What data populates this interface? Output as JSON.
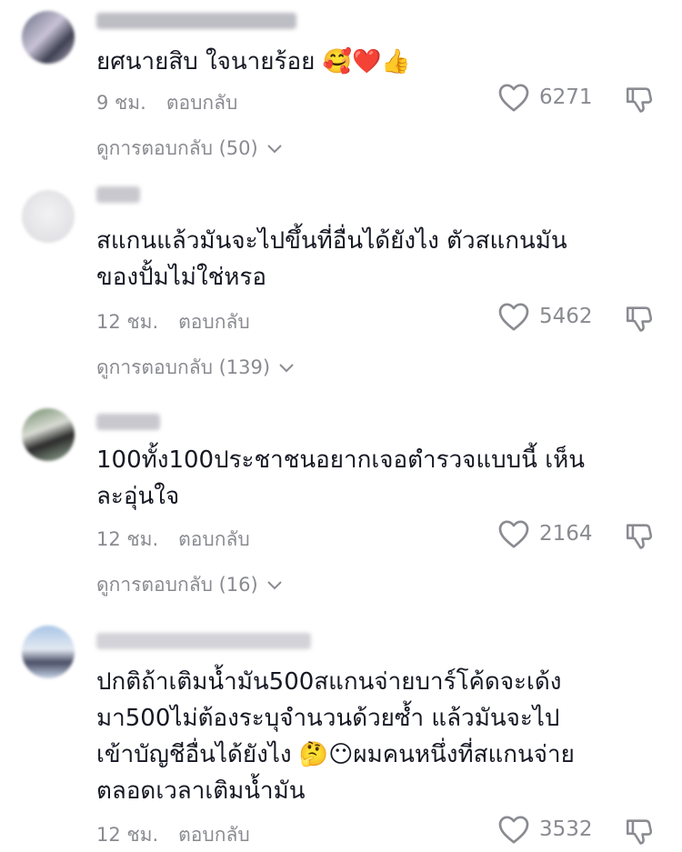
{
  "comments": [
    {
      "text": "ยศนายสิบ ใจนายร้อย 🥰❤️👍",
      "time": "9 ชม.",
      "reply_label": "ตอบกลับ",
      "likes": "6271",
      "view_replies": "ดูการตอบกลับ (50)"
    },
    {
      "text": "สแกนแล้วมันจะไปขึ้นที่อื่นได้ยังไง ตัวสแกนมันของปั้มไม่ใช่หรอ",
      "time": "12 ชม.",
      "reply_label": "ตอบกลับ",
      "likes": "5462",
      "view_replies": "ดูการตอบกลับ (139)"
    },
    {
      "text": "100ทั้ง100ประชาชนอยากเจอตำรวจแบบนี้ เห็นละอุ่นใจ",
      "time": "12 ชม.",
      "reply_label": "ตอบกลับ",
      "likes": "2164",
      "view_replies": "ดูการตอบกลับ (16)"
    },
    {
      "text": "ปกติถ้าเติมน้ำมัน500สแกนจ่ายบาร์โค้ดจะเด้งมา500ไม่ต้องระบุจำนวนด้วยซ้ำ แล้วมันจะไปเข้าบัญชีอื่นได้ยังไง 🤔😶ผมคนหนึ่งที่สแกนจ่ายตลอดเวลาเติมน้ำมัน",
      "time": "12 ชม.",
      "reply_label": "ตอบกลับ",
      "likes": "3532"
    }
  ],
  "icons": {
    "like": "heart-outline-icon",
    "dislike": "thumbs-down-outline-icon",
    "expand": "chevron-down-icon"
  },
  "colors": {
    "text": "#161823",
    "muted": "#8a8b91"
  }
}
